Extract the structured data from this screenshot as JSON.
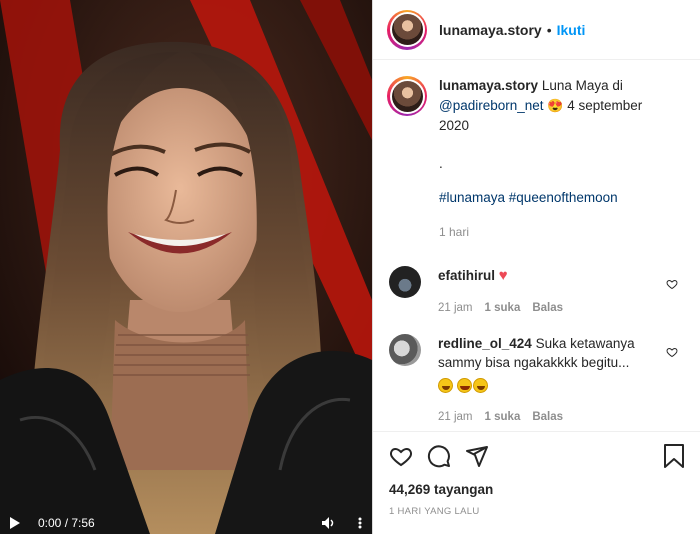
{
  "header": {
    "username": "lunamaya.story",
    "separator": "•",
    "follow_label": "Ikuti"
  },
  "caption": {
    "username": "lunamaya.story",
    "text_1": "Luna Maya di",
    "mention": "@padireborn_net",
    "text_2": "4 september 2020",
    "dot": ".",
    "hashtags": "#lunamaya #queenofthemoon",
    "age": "1 hari"
  },
  "comments": [
    {
      "username": "efatihirul",
      "text": "",
      "age": "21 jam",
      "likes": "1 suka",
      "reply_label": "Balas"
    },
    {
      "username": "redline_ol_424",
      "text": "Suka ketawanya sammy bisa ngakakkkk begitu...",
      "age": "21 jam",
      "likes": "1 suka",
      "reply_label": "Balas"
    }
  ],
  "stats": {
    "views": "44,269 tayangan",
    "date": "1 HARI YANG LALU"
  },
  "video": {
    "time": "0:00 / 7:56"
  },
  "colors": {
    "accent": "#0095f6",
    "heart": "#ed4956",
    "muted": "#8e8e8e"
  }
}
